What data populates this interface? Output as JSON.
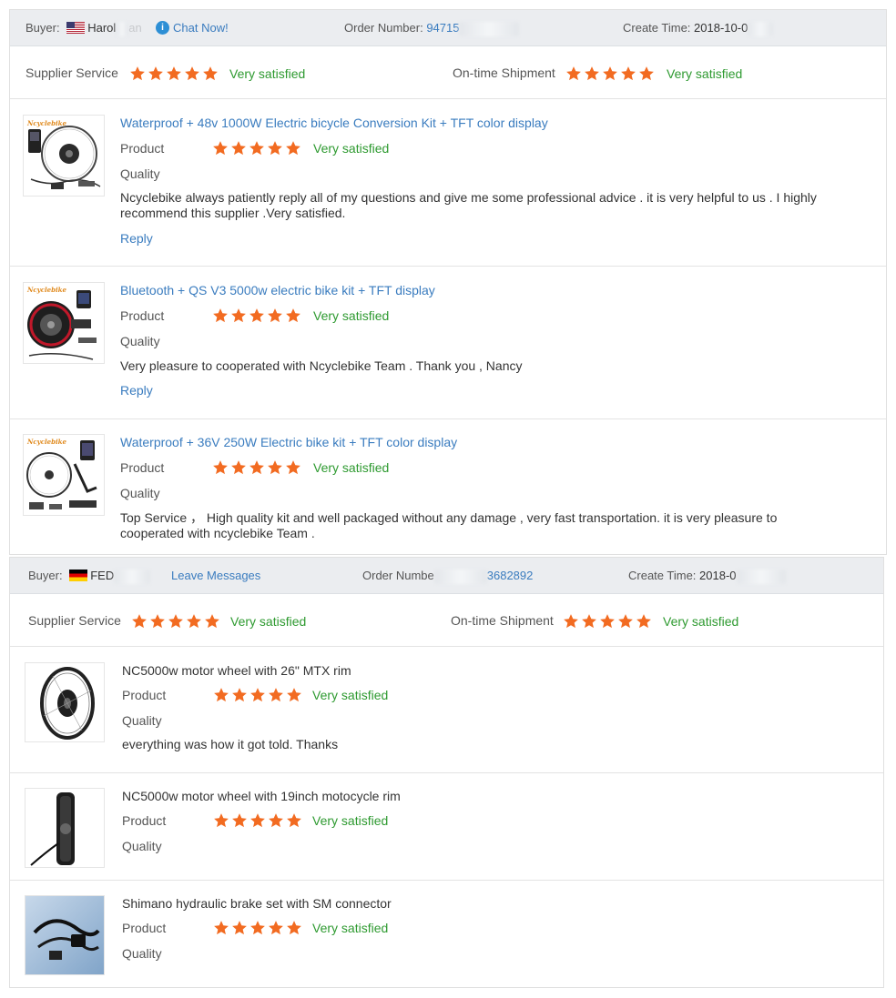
{
  "colors": {
    "star": "#f26b21",
    "link": "#3a7cbf",
    "satisfied": "#2e9a30",
    "header_bg": "#ebedf0"
  },
  "orders": [
    {
      "buyer_label": "Buyer:",
      "buyer_flag": "us-flag-icon",
      "buyer_name": "Harol",
      "buyer_name_tail": "an",
      "contact_label": "Chat Now!",
      "order_number_label": "Order Number:",
      "order_number": "94715",
      "create_time_label": "Create Time:",
      "create_time": "2018-10-0",
      "supplier_service_label": "Supplier Service",
      "supplier_service_rating": 5,
      "supplier_service_text": "Very satisfied",
      "shipment_label": "On-time Shipment",
      "shipment_rating": 5,
      "shipment_text": "Very satisfied",
      "items": [
        {
          "title": "Waterproof + 48v 1000W Electric bicycle Conversion Kit + TFT color display",
          "product_label": "Product",
          "quality_label": "Quality",
          "rating": 5,
          "rating_text": "Very satisfied",
          "comment": "Ncyclebike always patiently reply all of my questions and give me some professional advice . it is very helpful to us . I highly recommend this supplier .Very satisfied.",
          "reply_label": "Reply",
          "thumb_brand": "Ncyclebike"
        },
        {
          "title": "Bluetooth + QS V3 5000w electric bike kit + TFT display",
          "product_label": "Product",
          "quality_label": "Quality",
          "rating": 5,
          "rating_text": "Very satisfied",
          "comment": "Very pleasure to cooperated with Ncyclebike Team . Thank you , Nancy",
          "reply_label": "Reply",
          "thumb_brand": "Ncyclebike"
        },
        {
          "title": "Waterproof + 36V 250W Electric bike kit + TFT color display",
          "product_label": "Product",
          "quality_label": "Quality",
          "rating": 5,
          "rating_text": "Very satisfied",
          "comment": "Top Service ， High quality kit and well packaged without any damage , very fast transportation. it is very pleasure to cooperated with ncyclebike Team .",
          "thumb_brand": "Ncyclebike"
        }
      ]
    },
    {
      "buyer_label": "Buyer:",
      "buyer_flag": "de-flag-icon",
      "buyer_name": "FED",
      "contact_label": "Leave Messages",
      "order_number_label": "Order Numbe",
      "order_number": "3682892",
      "create_time_label": "Create Time:",
      "create_time": "2018-0",
      "supplier_service_label": "Supplier Service",
      "supplier_service_rating": 5,
      "supplier_service_text": "Very satisfied",
      "shipment_label": "On-time Shipment",
      "shipment_rating": 5,
      "shipment_text": "Very satisfied",
      "items": [
        {
          "title": "NC5000w motor wheel with 26\" MTX rim",
          "product_label": "Product",
          "quality_label": "Quality",
          "rating": 5,
          "rating_text": "Very satisfied",
          "comment": "everything was how it got told. Thanks"
        },
        {
          "title": "NC5000w motor wheel with 19inch motocycle rim",
          "product_label": "Product",
          "quality_label": "Quality",
          "rating": 5,
          "rating_text": "Very satisfied"
        },
        {
          "title": "Shimano hydraulic brake set with SM connector",
          "product_label": "Product",
          "quality_label": "Quality",
          "rating": 5,
          "rating_text": "Very satisfied"
        }
      ]
    }
  ]
}
